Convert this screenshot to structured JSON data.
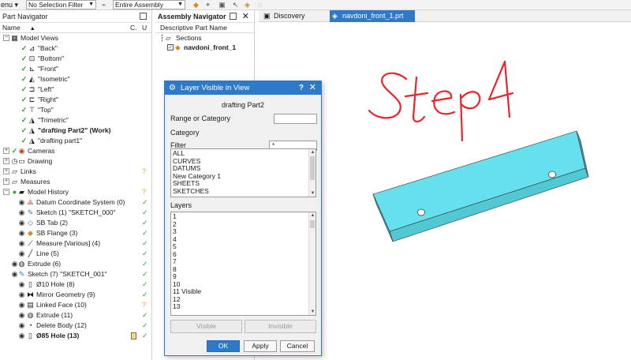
{
  "toolbar": {
    "menu_label": "enu ▾",
    "selection_filter": "No Selection Filter",
    "scope": "Entire Assembly"
  },
  "part_navigator": {
    "title": "Part Navigator",
    "col_name": "Name",
    "col_c": "C.",
    "col_u": "U",
    "model_views_label": "Model Views",
    "views": [
      "\"Back\"",
      "\"Bottom\"",
      "\"Front\"",
      "\"Isometric\"",
      "\"Left\"",
      "\"Right\"",
      "\"Top\"",
      "\"Trimetric\"",
      "\"drafting Part2\" (Work)",
      "\"drafting part1\""
    ],
    "cameras_label": "Cameras",
    "drawing_label": "Drawing",
    "links_label": "Links",
    "measures_label": "Measures",
    "history_label": "Model History",
    "features": [
      "Datum Coordinate System (0)",
      "Sketch (1) \"SKETCH_000\"",
      "SB Tab (2)",
      "SB Flange (3)",
      "Measure [Various] (4)",
      "Line (5)",
      "Extrude (6)",
      "Sketch (7) \"SKETCH_001\"",
      "Ø10 Hole (8)",
      "Mirror Geometry (9)",
      "Linked Face (10)",
      "Extrude (11)",
      "Delete Body (12)",
      "Ø85 Hole (13)"
    ]
  },
  "assembly_navigator": {
    "title": "Assembly Navigator",
    "col_header": "Descriptive Part Name",
    "sections_label": "Sections",
    "part_label": "navdoni_front_1"
  },
  "tabs": {
    "discovery": "Discovery Center",
    "part_file": "navdoni_front_1.prt"
  },
  "dialog": {
    "title": "Layer Visible in View",
    "view_name": "drafting Part2",
    "range_label": "Range or Category",
    "range_value": "",
    "category_label": "Category",
    "filter_label": "Filter",
    "filter_value": "*",
    "categories": [
      "ALL",
      "CURVES",
      "DATUMS",
      "New Category 1",
      "SHEETS",
      "SKETCHES"
    ],
    "layers_label": "Layers",
    "layers": [
      "1",
      "2",
      "3",
      "4",
      "5",
      "6",
      "7",
      "8",
      "9",
      "10",
      "11 Visible",
      "12",
      "13"
    ],
    "visible_button": "Visible",
    "invisible_button": "Invisible",
    "ok_button": "OK",
    "apply_button": "Apply",
    "cancel_button": "Cancel"
  },
  "annotation": {
    "handwritten_text": "Step4",
    "ink_color": "#e3262b"
  },
  "colors": {
    "accent": "#2f79c9",
    "part_face": "#66e0ec",
    "check": "#2aa52a"
  }
}
